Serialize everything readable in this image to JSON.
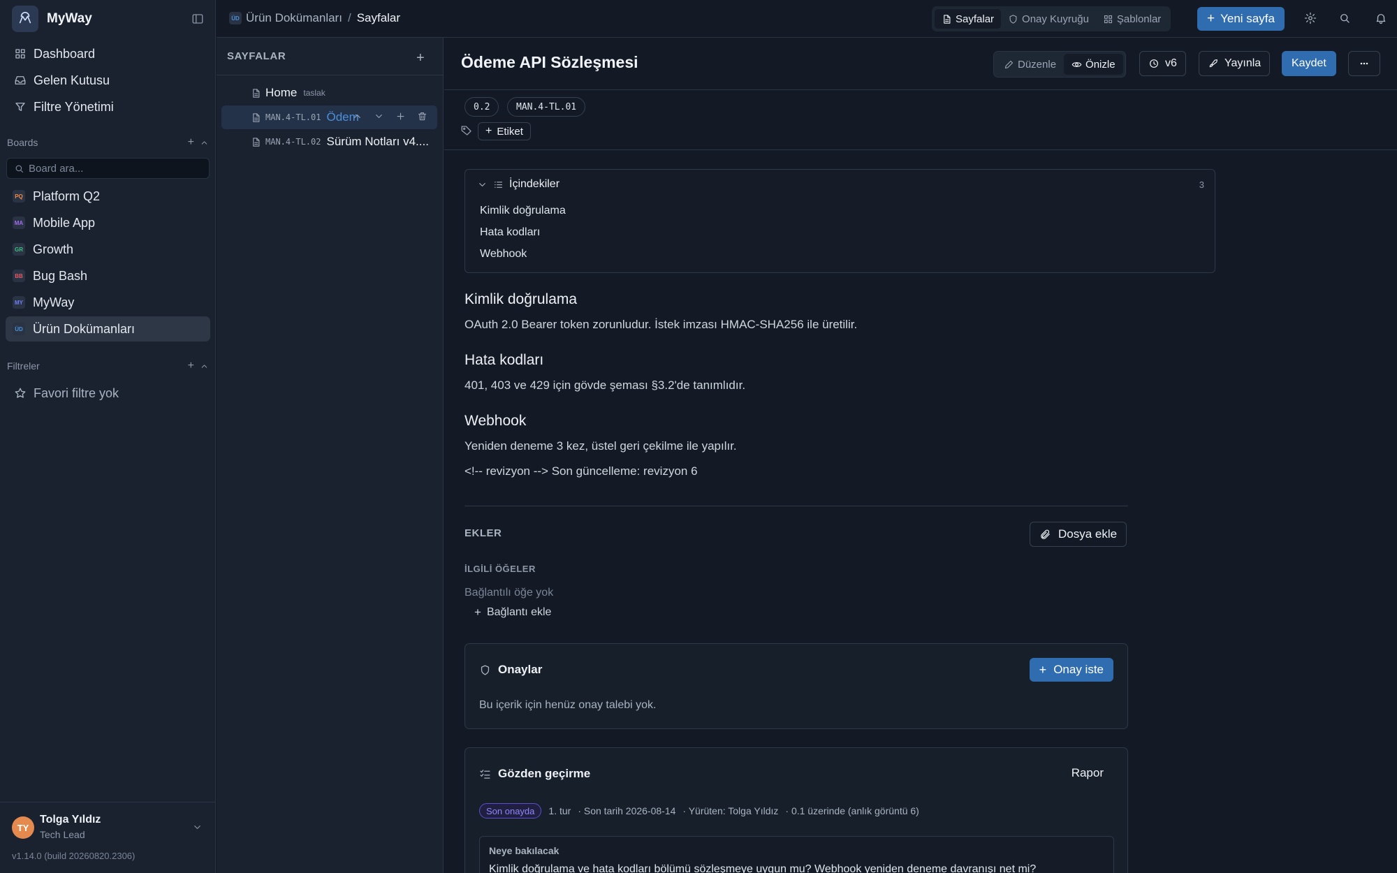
{
  "app": {
    "name": "MyWay",
    "version": "v1.14.0 (build 20260820.2306)"
  },
  "sidebar": {
    "nav": [
      {
        "label": "Dashboard",
        "icon": "grid-icon"
      },
      {
        "label": "Gelen Kutusu",
        "icon": "inbox-icon"
      },
      {
        "label": "Filtre Yönetimi",
        "icon": "filter-icon"
      }
    ],
    "boards_label": "Boards",
    "board_search_placeholder": "Board ara...",
    "boards": [
      {
        "label": "Platform Q2",
        "badge": "PQ",
        "color": "#f08c4a",
        "active": false
      },
      {
        "label": "Mobile App",
        "badge": "MA",
        "color": "#a26bf0",
        "active": false
      },
      {
        "label": "Growth",
        "badge": "GR",
        "color": "#3fbf83",
        "active": false
      },
      {
        "label": "Bug Bash",
        "badge": "BB",
        "color": "#e25a67",
        "active": false
      },
      {
        "label": "MyWay",
        "badge": "MY",
        "color": "#6f7ff5",
        "active": false
      },
      {
        "label": "Ürün Dokümanları",
        "badge": "ÜD",
        "color": "#4a8fd9",
        "active": true
      }
    ],
    "filters_label": "Filtreler",
    "no_filters": "Favori filtre yok",
    "user": {
      "initials": "TY",
      "name": "Tolga Yıldız",
      "role": "Tech Lead"
    }
  },
  "topbar": {
    "crumb_badge": "ÜD",
    "crumb_parent": "Ürün Dokümanları",
    "crumb_sep": "/",
    "crumb_current": "Sayfalar",
    "tabs": [
      {
        "label": "Sayfalar",
        "icon": "file-icon",
        "active": true
      },
      {
        "label": "Onay Kuyruğu",
        "icon": "shield-icon",
        "active": false
      },
      {
        "label": "Şablonlar",
        "icon": "grid-icon",
        "active": false
      }
    ],
    "new_page_label": "Yeni sayfa"
  },
  "pages_panel": {
    "title": "SAYFALAR",
    "pages": [
      {
        "id": "",
        "title": "Home",
        "tag": "taslak",
        "active": false
      },
      {
        "id": "MAN.4-TL.01",
        "title": "Ödem",
        "tag": "",
        "active": true
      },
      {
        "id": "MAN.4-TL.02",
        "title": "Sürüm Notları v4....",
        "tag": "",
        "active": false
      }
    ]
  },
  "document": {
    "title": "Ödeme API Sözleşmesi",
    "modes": [
      {
        "label": "Düzenle",
        "icon": "pencil-icon",
        "active": false
      },
      {
        "label": "Önizle",
        "icon": "eye-icon",
        "active": true
      }
    ],
    "version_label": "v6",
    "publish_label": "Yayınla",
    "save_label": "Kaydet",
    "chips": [
      "0.2",
      "MAN.4-TL.01"
    ],
    "tag_button": "Etiket",
    "toc": {
      "title": "İçindekiler",
      "count": "3",
      "items": [
        "Kimlik doğrulama",
        "Hata kodları",
        "Webhook"
      ]
    },
    "sections": [
      {
        "heading": "Kimlik doğrulama",
        "text": "OAuth 2.0 Bearer token zorunludur. İstek imzası HMAC-SHA256 ile üretilir."
      },
      {
        "heading": "Hata kodları",
        "text": "401, 403 ve 429 için gövde şeması §3.2'de tanımlıdır."
      },
      {
        "heading": "Webhook",
        "text": "Yeniden deneme 3 kez, üstel geri çekilme ile yapılır."
      }
    ],
    "revision_note": "<!-- revizyon --> Son güncelleme: revizyon 6",
    "attachments_label": "EKLER",
    "attach_button": "Dosya ekle",
    "related_label": "İLGİLİ ÖĞELER",
    "no_related": "Bağlantılı öğe yok",
    "add_link": "Bağlantı ekle",
    "approvals": {
      "title": "Onaylar",
      "button": "Onay iste",
      "empty": "Bu içerik için henüz onay talebi yok."
    },
    "review": {
      "title": "Gözden geçirme",
      "report": "Rapor",
      "status": "Son onayda",
      "round": "1. tur",
      "due": "· Son tarih 2026-08-14",
      "owner": "· Yürüten: Tolga Yıldız",
      "snapshot": "· 0.1 üzerinde (anlık görüntü 6)",
      "focus_label": "Neye bakılacak",
      "focus_text": "Kimlik doğrulama ve hata kodları bölümü sözleşmeye uygun mu? Webhook yeniden deneme davranışı net mi?"
    }
  }
}
